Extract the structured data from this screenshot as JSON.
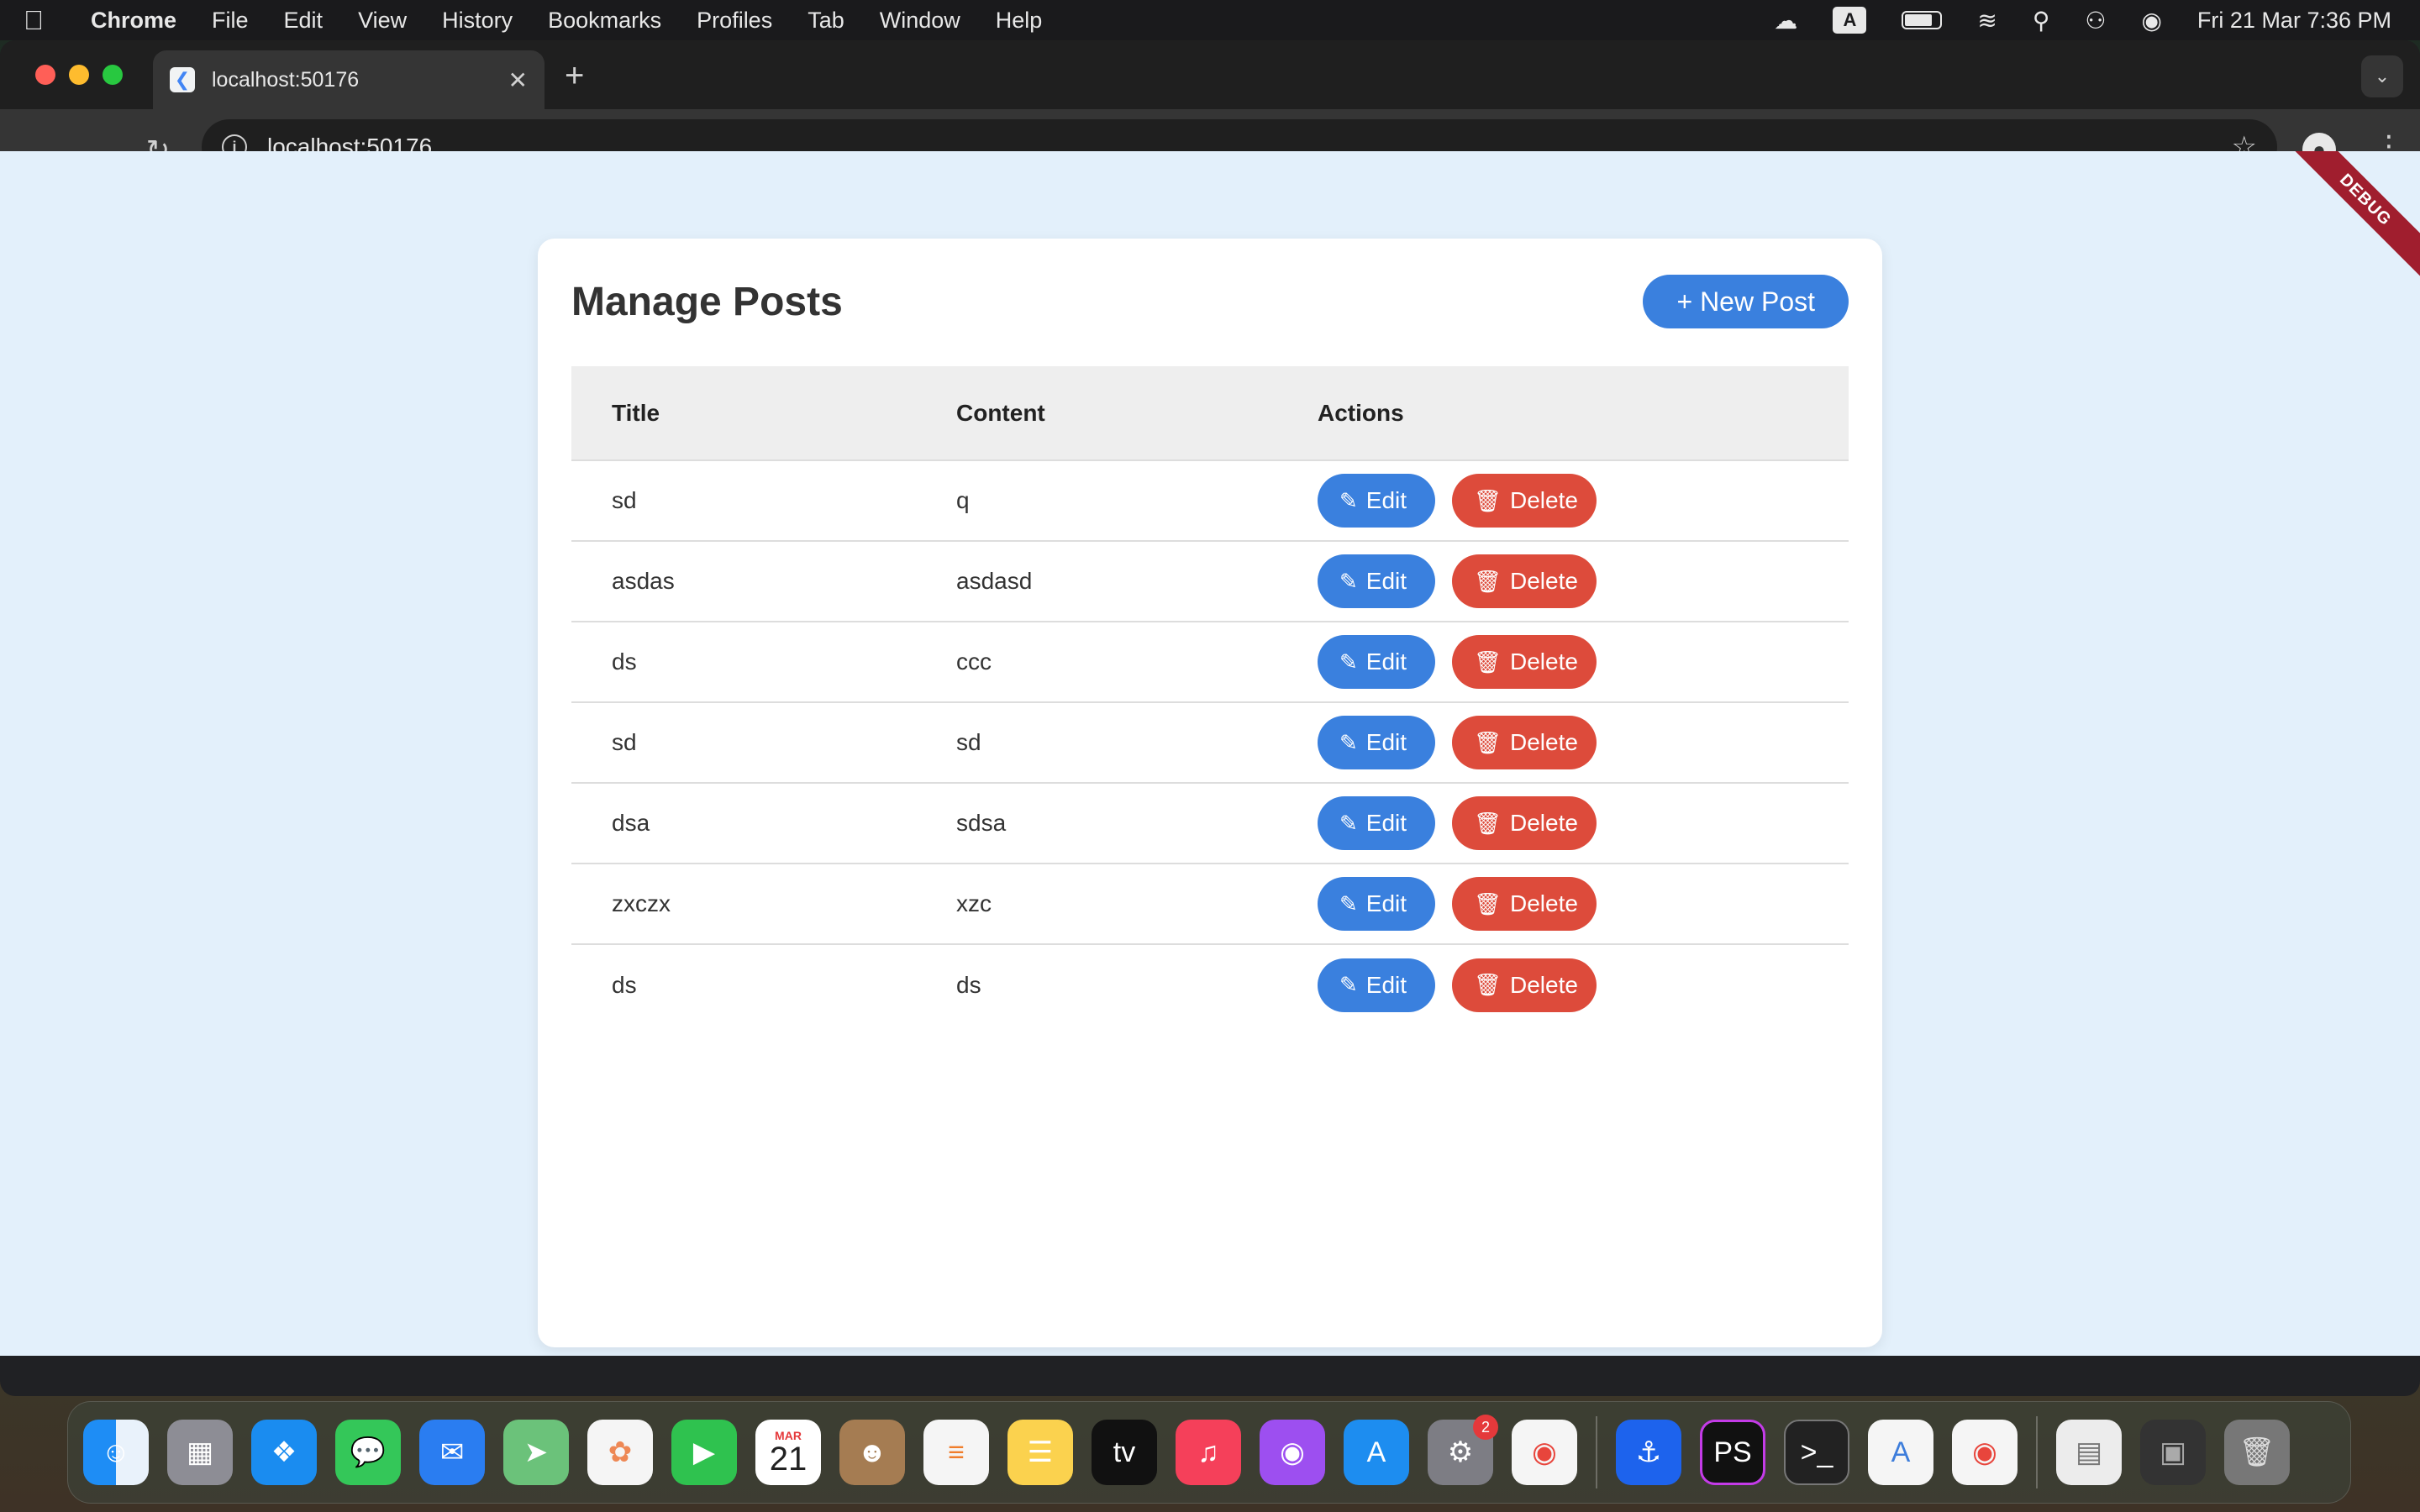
{
  "menubar": {
    "app_name": "Chrome",
    "items": [
      "File",
      "Edit",
      "View",
      "History",
      "Bookmarks",
      "Profiles",
      "Tab",
      "Window",
      "Help"
    ],
    "input_badge": "A",
    "datetime": "Fri 21 Mar  7:36 PM"
  },
  "browser": {
    "tab_title": "localhost:50176",
    "url": "localhost:50176"
  },
  "page": {
    "debug_banner": "DEBUG",
    "title": "Manage Posts",
    "new_post_label": "+ New Post",
    "columns": [
      "Title",
      "Content",
      "Actions"
    ],
    "edit_label": "Edit",
    "delete_label": "Delete",
    "rows": [
      {
        "title": "sd",
        "content": "q"
      },
      {
        "title": "asdas",
        "content": "asdasd"
      },
      {
        "title": "ds",
        "content": "ccc"
      },
      {
        "title": "sd",
        "content": "sd"
      },
      {
        "title": "dsa",
        "content": "sdsa"
      },
      {
        "title": "zxczx",
        "content": "xzc"
      },
      {
        "title": "ds",
        "content": "ds"
      }
    ]
  },
  "dock": {
    "calendar_month": "MAR",
    "calendar_day": "21",
    "settings_badge": "2",
    "apps": [
      "finder",
      "launchpad",
      "safari",
      "messages",
      "mail",
      "maps",
      "photos",
      "facetime",
      "calendar",
      "contacts",
      "reminders",
      "notes",
      "tv",
      "music",
      "podcasts",
      "app-store",
      "system-settings",
      "chrome",
      "docker",
      "phpstorm",
      "terminal",
      "android-studio",
      "chrome",
      "documents",
      "screen",
      "trash"
    ]
  },
  "colors": {
    "primary": "#3a80de",
    "danger": "#dd4b3b",
    "page_background": "#e3f0fb"
  }
}
